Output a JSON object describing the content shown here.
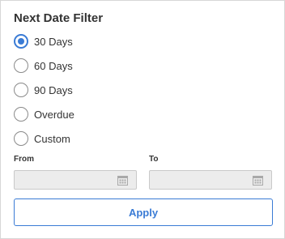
{
  "panel": {
    "title": "Next Date Filter"
  },
  "options": [
    {
      "label": "30 Days",
      "checked": true
    },
    {
      "label": "60 Days",
      "checked": false
    },
    {
      "label": "90 Days",
      "checked": false
    },
    {
      "label": "Overdue",
      "checked": false
    },
    {
      "label": "Custom",
      "checked": false
    }
  ],
  "range": {
    "from_label": "From",
    "to_label": "To",
    "from_value": "",
    "to_value": "",
    "icon": "calendar-icon"
  },
  "apply_label": "Apply",
  "colors": {
    "accent": "#3a7bd5",
    "disabled_field": "#ececec"
  }
}
